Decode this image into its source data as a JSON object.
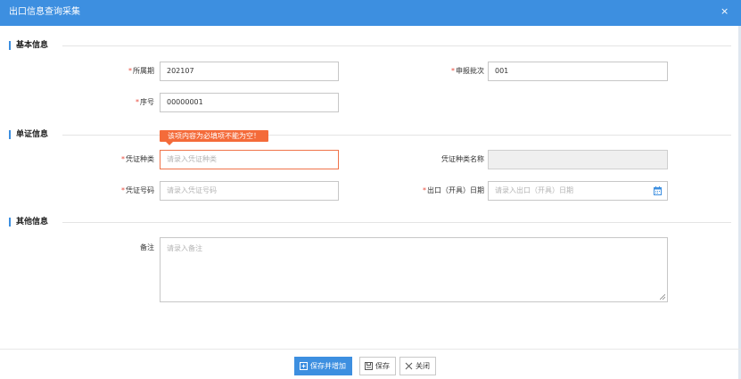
{
  "dialog": {
    "title": "出口信息查询采集",
    "close_glyph": "×"
  },
  "sections": {
    "basic": "基本信息",
    "voucher": "单证信息",
    "other": "其他信息"
  },
  "required_mark": "*",
  "fields": {
    "period": {
      "label": "所属期",
      "value": "202107"
    },
    "batch": {
      "label": "申报批次",
      "value": "001"
    },
    "seq": {
      "label": "序号",
      "value": "00000001"
    },
    "voucher_type": {
      "label": "凭证种类",
      "placeholder": "请录入凭证种类",
      "error": "该项内容为必填项不能为空！"
    },
    "voucher_type_name": {
      "label": "凭证种类名称",
      "value": ""
    },
    "voucher_no": {
      "label": "凭证号码",
      "placeholder": "请录入凭证号码"
    },
    "export_date": {
      "label": "出口（开具）日期",
      "placeholder": "请录入出口（开具）日期",
      "icon": "calendar-icon"
    },
    "remark": {
      "label": "备注",
      "placeholder": "请录入备注"
    }
  },
  "buttons": {
    "save_add": {
      "label": "保存并增加",
      "icon": "save-add-icon"
    },
    "save": {
      "label": "保存",
      "icon": "save-icon"
    },
    "close": {
      "label": "关闭",
      "icon": "close-icon"
    }
  },
  "colors": {
    "accent": "#3d8fe0",
    "error": "#f46b3a",
    "required": "#e84a3c"
  }
}
